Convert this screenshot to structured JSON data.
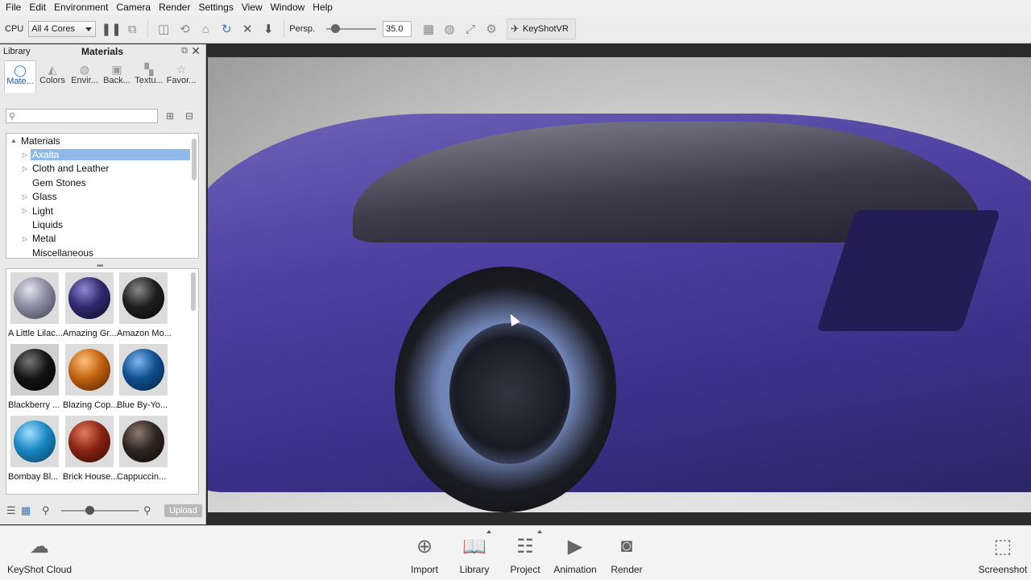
{
  "menu": [
    "File",
    "Edit",
    "Environment",
    "Camera",
    "Render",
    "Settings",
    "View",
    "Window",
    "Help"
  ],
  "toolbar": {
    "cpu_label": "CPU",
    "cores_value": "All 4 Cores",
    "persp_label": "Persp.",
    "fov_value": "35.0",
    "vr_label": "KeyShotVR"
  },
  "panel": {
    "library_label": "Library",
    "title": "Materials",
    "tabs": [
      {
        "label": "Mate...",
        "icon": "materials-icon",
        "active": true
      },
      {
        "label": "Colors",
        "icon": "colors-icon"
      },
      {
        "label": "Envir...",
        "icon": "environments-icon"
      },
      {
        "label": "Back...",
        "icon": "backplates-icon"
      },
      {
        "label": "Textu...",
        "icon": "textures-icon"
      },
      {
        "label": "Favor...",
        "icon": "favorites-icon"
      }
    ],
    "search_placeholder": "",
    "tree": [
      {
        "label": "Materials",
        "twisty": "▲",
        "indent": 0
      },
      {
        "label": "Axalta",
        "twisty": "▷",
        "indent": 1,
        "selected": true
      },
      {
        "label": "Cloth and Leather",
        "twisty": "▷",
        "indent": 1
      },
      {
        "label": "Gem Stones",
        "twisty": "",
        "indent": 1
      },
      {
        "label": "Glass",
        "twisty": "▷",
        "indent": 1
      },
      {
        "label": "Light",
        "twisty": "▷",
        "indent": 1
      },
      {
        "label": "Liquids",
        "twisty": "",
        "indent": 1
      },
      {
        "label": "Metal",
        "twisty": "▷",
        "indent": 1
      },
      {
        "label": "Miscellaneous",
        "twisty": "",
        "indent": 1
      }
    ],
    "materials": [
      {
        "label": "A Little Lilac...",
        "color": "#8a8aa0"
      },
      {
        "label": "Amazing Gr...",
        "color": "#2e2a6e"
      },
      {
        "label": "Amazon Mo...",
        "color": "#1f1f1f"
      },
      {
        "label": "Blackberry ...",
        "color": "#141414",
        "selected": true
      },
      {
        "label": "Blazing Cop...",
        "color": "#c0620f"
      },
      {
        "label": "Blue By-Yo...",
        "color": "#0f4f8f"
      },
      {
        "label": "Bombay Bl...",
        "color": "#1a86c2"
      },
      {
        "label": "Brick House...",
        "color": "#8a2412"
      },
      {
        "label": "Cappuccin...",
        "color": "#2f2520"
      }
    ],
    "upload_label": "Upload"
  },
  "bottom": {
    "cloud_label": "KeyShot Cloud",
    "buttons": [
      {
        "label": "Import",
        "icon": "import-icon"
      },
      {
        "label": "Library",
        "icon": "library-icon",
        "active": true
      },
      {
        "label": "Project",
        "icon": "project-icon"
      },
      {
        "label": "Animation",
        "icon": "animation-icon"
      },
      {
        "label": "Render",
        "icon": "render-icon"
      }
    ],
    "screenshot_label": "Screenshot"
  },
  "colors": {
    "accent": "#2a7bd6",
    "selection": "#8fb9e8",
    "car_paint": "#4d40a0"
  }
}
